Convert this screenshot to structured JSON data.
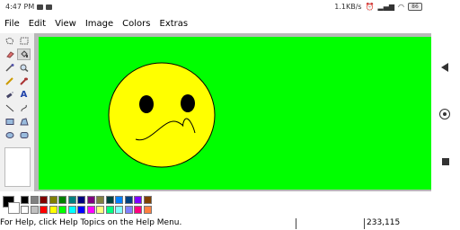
{
  "phone_status": {
    "time": "4:47 PM",
    "network_speed": "1.1KB/s",
    "battery": "86"
  },
  "menu": [
    "File",
    "Edit",
    "View",
    "Image",
    "Colors",
    "Extras"
  ],
  "tools": [
    {
      "name": "free-select-icon",
      "glyph": "⬠"
    },
    {
      "name": "rect-select-icon",
      "glyph": "⬚"
    },
    {
      "name": "eraser-icon",
      "glyph": "▰"
    },
    {
      "name": "fill-icon",
      "glyph": "⛾"
    },
    {
      "name": "color-picker-icon",
      "glyph": "✎"
    },
    {
      "name": "magnifier-icon",
      "glyph": "🔍"
    },
    {
      "name": "pencil-icon",
      "glyph": "✏"
    },
    {
      "name": "brush-icon",
      "glyph": "🖌"
    },
    {
      "name": "airbrush-icon",
      "glyph": "✧"
    },
    {
      "name": "text-icon",
      "glyph": "A"
    },
    {
      "name": "line-icon",
      "glyph": "╲"
    },
    {
      "name": "curve-icon",
      "glyph": "∿"
    },
    {
      "name": "rectangle-icon",
      "glyph": "▭"
    },
    {
      "name": "polygon-icon",
      "glyph": "⏢"
    },
    {
      "name": "ellipse-icon",
      "glyph": "⬭"
    },
    {
      "name": "rounded-rect-icon",
      "glyph": "▢"
    }
  ],
  "palette": {
    "foreground": "#000000",
    "background": "#ffffff",
    "top_row": [
      "#000000",
      "#808080",
      "#800000",
      "#808000",
      "#008000",
      "#008080",
      "#000080",
      "#800080",
      "#808040",
      "#004040",
      "#0080ff",
      "#004080",
      "#8000ff",
      "#804000"
    ],
    "bottom_row": [
      "#ffffff",
      "#c0c0c0",
      "#ff0000",
      "#ffff00",
      "#00ff00",
      "#00ffff",
      "#0000ff",
      "#ff00ff",
      "#ffff80",
      "#00ff80",
      "#80ffff",
      "#8080ff",
      "#ff0080",
      "#ff8040"
    ]
  },
  "canvas": {
    "background": "#00ff00",
    "face_color": "#ffff00",
    "eye_color": "#000000"
  },
  "status": {
    "help_text": "For Help, click Help Topics on the Help Menu.",
    "coordinates": "233,115"
  }
}
